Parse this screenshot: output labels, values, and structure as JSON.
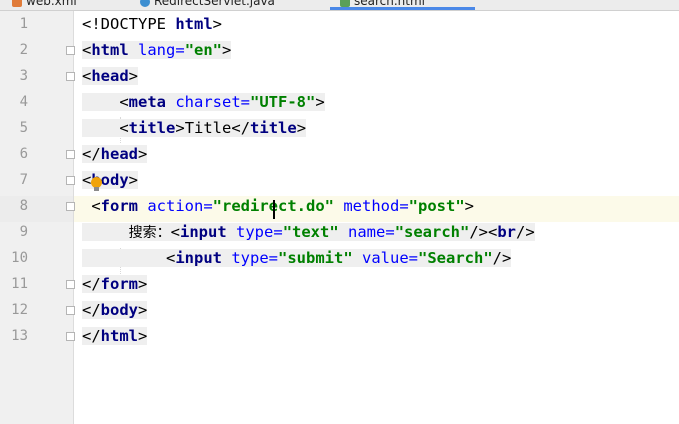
{
  "tabs": [
    {
      "label": "web.xml",
      "icon": "xml-file-icon",
      "color": "#e07b39"
    },
    {
      "label": "RedirectServlet.java",
      "icon": "java-class-icon",
      "color": "#3d8fd1"
    },
    {
      "label": "search.html",
      "icon": "html-file-icon",
      "color": "#5aa05a",
      "active": true
    }
  ],
  "editor": {
    "line_numbers": [
      "1",
      "2",
      "3",
      "4",
      "5",
      "6",
      "7",
      "8",
      "9",
      "10",
      "11",
      "12",
      "13"
    ],
    "lines": [
      [
        {
          "t": "<!DOCTYPE ",
          "c": "punc"
        },
        {
          "t": "html",
          "c": "tag"
        },
        {
          "t": ">",
          "c": "punc"
        }
      ],
      [
        {
          "t": "<",
          "c": "punc"
        },
        {
          "t": "html ",
          "c": "tag"
        },
        {
          "t": "lang=",
          "c": "attr"
        },
        {
          "t": "\"en\"",
          "c": "str"
        },
        {
          "t": ">",
          "c": "punc"
        }
      ],
      [
        {
          "t": "<",
          "c": "punc"
        },
        {
          "t": "head",
          "c": "tag"
        },
        {
          "t": ">",
          "c": "punc"
        }
      ],
      [
        {
          "t": "    <",
          "c": "punc"
        },
        {
          "t": "meta ",
          "c": "tag"
        },
        {
          "t": "charset=",
          "c": "attr"
        },
        {
          "t": "\"UTF-8\"",
          "c": "str"
        },
        {
          "t": ">",
          "c": "punc"
        }
      ],
      [
        {
          "t": "    <",
          "c": "punc"
        },
        {
          "t": "title",
          "c": "tag"
        },
        {
          "t": ">",
          "c": "punc"
        },
        {
          "t": "Title",
          "c": "plain"
        },
        {
          "t": "</",
          "c": "punc"
        },
        {
          "t": "title",
          "c": "tag"
        },
        {
          "t": ">",
          "c": "punc"
        }
      ],
      [
        {
          "t": "</",
          "c": "punc"
        },
        {
          "t": "head",
          "c": "tag"
        },
        {
          "t": ">",
          "c": "punc"
        }
      ],
      [
        {
          "t": "<",
          "c": "punc"
        },
        {
          "t": "body",
          "c": "tag"
        },
        {
          "t": ">",
          "c": "punc"
        }
      ],
      [
        {
          "t": " <",
          "c": "punc"
        },
        {
          "t": "form ",
          "c": "tag"
        },
        {
          "t": "action=",
          "c": "attr"
        },
        {
          "t": "\"redirect.do\" ",
          "c": "str"
        },
        {
          "t": "method=",
          "c": "attr"
        },
        {
          "t": "\"post\"",
          "c": "str"
        },
        {
          "t": ">",
          "c": "punc"
        }
      ],
      [
        {
          "t": "     ",
          "c": "plain"
        },
        {
          "t": "搜索：",
          "c": "cjk"
        },
        {
          "t": "<",
          "c": "punc"
        },
        {
          "t": "input ",
          "c": "tag"
        },
        {
          "t": "type=",
          "c": "attr"
        },
        {
          "t": "\"text\" ",
          "c": "str"
        },
        {
          "t": "name=",
          "c": "attr"
        },
        {
          "t": "\"search\"",
          "c": "str"
        },
        {
          "t": "/><",
          "c": "punc"
        },
        {
          "t": "br",
          "c": "tag"
        },
        {
          "t": "/>",
          "c": "punc"
        }
      ],
      [
        {
          "t": "         <",
          "c": "punc"
        },
        {
          "t": "input ",
          "c": "tag"
        },
        {
          "t": "type=",
          "c": "attr"
        },
        {
          "t": "\"submit\" ",
          "c": "str"
        },
        {
          "t": "value=",
          "c": "attr"
        },
        {
          "t": "\"Search\"",
          "c": "str"
        },
        {
          "t": "/>",
          "c": "punc"
        }
      ],
      [
        {
          "t": "</",
          "c": "punc"
        },
        {
          "t": "form",
          "c": "tag"
        },
        {
          "t": ">",
          "c": "punc"
        }
      ],
      [
        {
          "t": "</",
          "c": "punc"
        },
        {
          "t": "body",
          "c": "tag"
        },
        {
          "t": ">",
          "c": "punc"
        }
      ],
      [
        {
          "t": "</",
          "c": "punc"
        },
        {
          "t": "html",
          "c": "tag"
        },
        {
          "t": ">",
          "c": "punc"
        }
      ]
    ],
    "current_line": 8,
    "folds": [
      2,
      3,
      6,
      7,
      8,
      11,
      12,
      13
    ]
  }
}
